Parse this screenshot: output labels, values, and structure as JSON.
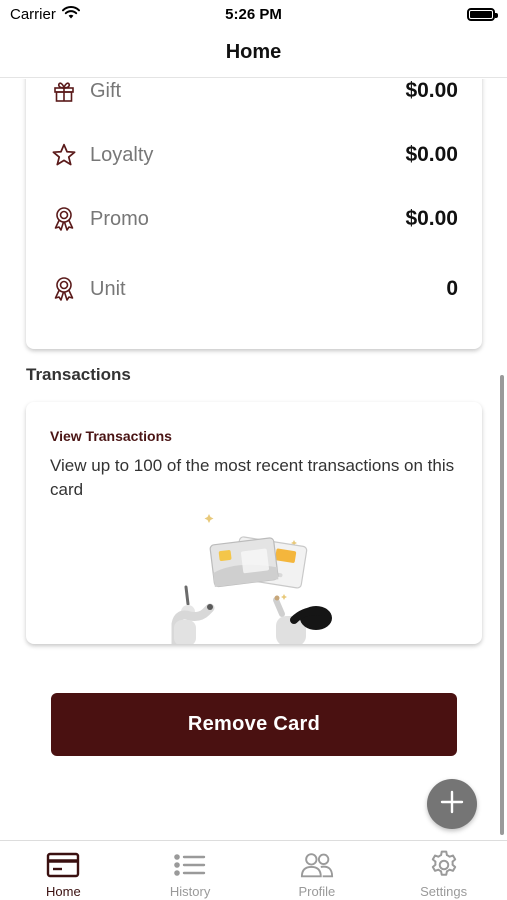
{
  "status_bar": {
    "carrier": "Carrier",
    "time": "5:26 PM"
  },
  "nav": {
    "title": "Home"
  },
  "balances": [
    {
      "label": "Gift",
      "value": "$0.00",
      "icon": "gift-icon"
    },
    {
      "label": "Loyalty",
      "value": "$0.00",
      "icon": "star-icon"
    },
    {
      "label": "Promo",
      "value": "$0.00",
      "icon": "award-icon"
    },
    {
      "label": "Unit",
      "value": "0",
      "icon": "award-icon"
    }
  ],
  "transactions": {
    "section_title": "Transactions",
    "card_title": "View Transactions",
    "description": "View up to 100 of the most recent transactions on this card"
  },
  "remove_button": {
    "label": "Remove Card"
  },
  "tabs": [
    {
      "label": "Home",
      "icon": "card-icon",
      "active": true
    },
    {
      "label": "History",
      "icon": "list-icon",
      "active": false
    },
    {
      "label": "Profile",
      "icon": "people-icon",
      "active": false
    },
    {
      "label": "Settings",
      "icon": "gear-icon",
      "active": false
    }
  ],
  "colors": {
    "accent": "#4a1111",
    "inactive_tab": "#9a9a9a",
    "fab": "#757575"
  }
}
